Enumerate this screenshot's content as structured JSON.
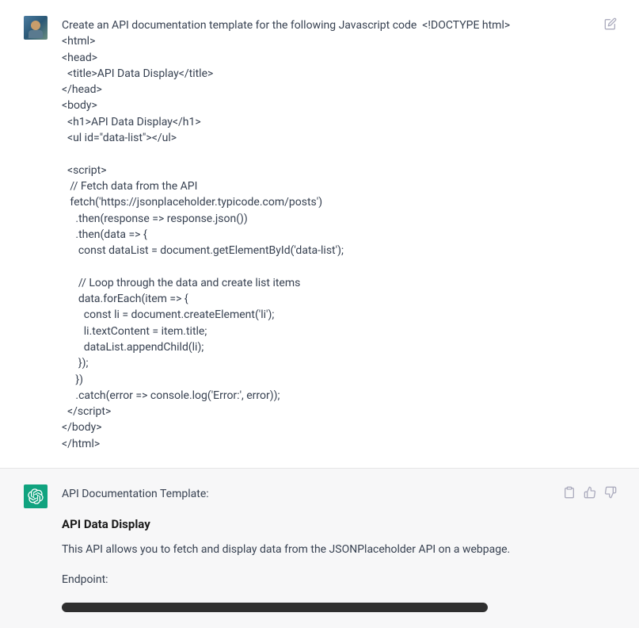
{
  "user_message": {
    "text": "Create an API documentation template for the following Javascript code  <!DOCTYPE html>\n<html>\n<head>\n  <title>API Data Display</title>\n</head>\n<body>\n  <h1>API Data Display</h1>\n  <ul id=\"data-list\"></ul>\n\n  <script>\n   // Fetch data from the API\n   fetch('https://jsonplaceholder.typicode.com/posts')\n     .then(response => response.json())\n     .then(data => {\n      const dataList = document.getElementById('data-list');\n\n      // Loop through the data and create list items\n      data.forEach(item => {\n        const li = document.createElement('li');\n        li.textContent = item.title;\n        dataList.appendChild(li);\n      });\n     })\n     .catch(error => console.log('Error:', error));\n  </script>\n</body>\n</html>"
  },
  "assistant_message": {
    "intro": "API Documentation Template:",
    "heading": "API Data Display",
    "description": "This API allows you to fetch and display data from the JSONPlaceholder API on a webpage.",
    "endpoint_label": "Endpoint:"
  },
  "icons": {
    "edit": "edit-icon",
    "clipboard": "clipboard-icon",
    "thumbs_up": "thumbs-up-icon",
    "thumbs_down": "thumbs-down-icon"
  }
}
